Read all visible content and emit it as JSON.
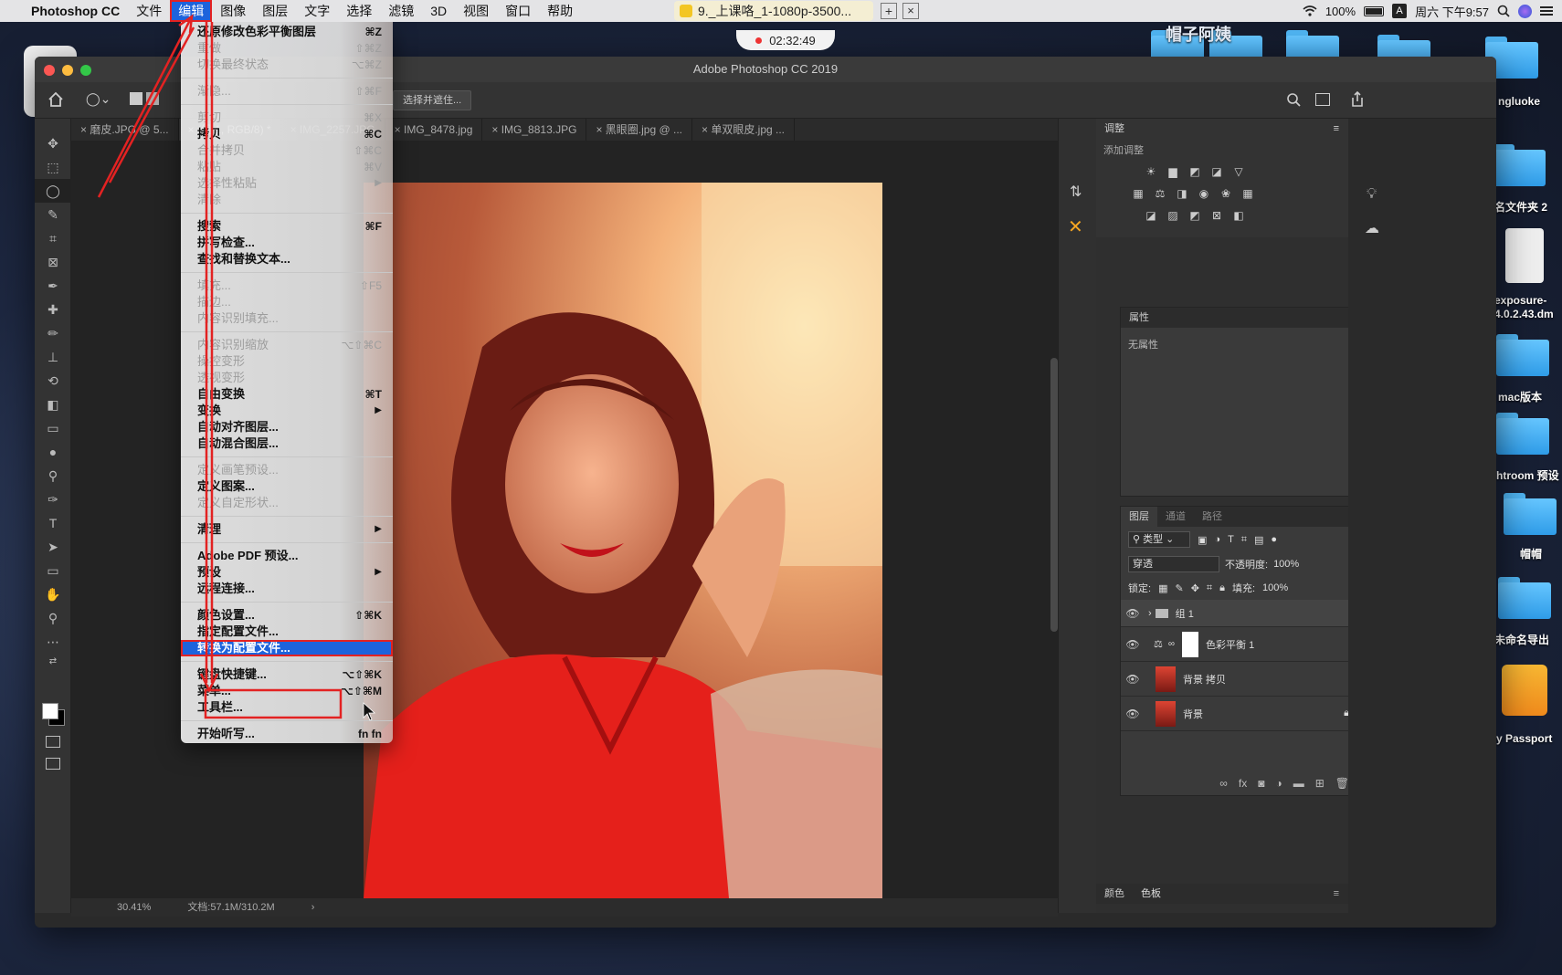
{
  "menubar": {
    "app": "Photoshop CC",
    "menus": [
      "文件",
      "编辑",
      "图像",
      "图层",
      "文字",
      "选择",
      "滤镜",
      "3D",
      "视图",
      "窗口",
      "帮助"
    ],
    "active_menu": "编辑",
    "video_title": "9._上课咯_1-1080p-3500...",
    "battery": "100%",
    "clock": "周六 下午9:57"
  },
  "recording": {
    "time": "02:32:49"
  },
  "desktop": {
    "labels": [
      "帽子阿姨",
      "ngluoke",
      "名文件夹 2",
      "exposure-4.0.2.43.dm",
      "mac版本",
      "htroom 预设",
      "帽帽",
      "未命名导出",
      "y Passport"
    ]
  },
  "ps": {
    "window_title": "Adobe Photoshop CC 2019",
    "options_button": "选择并遮住...",
    "tabs": [
      "磨皮.JPG @ 5...",
      "(组 1, RGB/8) *",
      "IMG_2257.JPG",
      "IMG_8478.jpg",
      "IMG_8813.JPG",
      "黑眼圈.jpg @ ...",
      "单双眼皮.jpg ..."
    ],
    "status_zoom": "30.41%",
    "status_doc": "文档:57.1M/310.2M"
  },
  "panels": {
    "adjust_tab": "调整",
    "adjust_add": "添加调整",
    "props_tab": "属性",
    "props_empty": "无属性",
    "layers_tabs": [
      "图层",
      "通道",
      "路径"
    ],
    "filter_kind": "类型",
    "blend_mode": "穿透",
    "opacity_label": "不透明度:",
    "opacity_value": "100%",
    "lock_label": "锁定:",
    "fill_label": "填充:",
    "fill_value": "100%",
    "layers": [
      {
        "name": "组 1",
        "type": "group"
      },
      {
        "name": "色彩平衡 1",
        "type": "adjustment"
      },
      {
        "name": "背景 拷贝",
        "type": "image"
      },
      {
        "name": "背景",
        "type": "image-locked"
      }
    ],
    "bottom_tabs": [
      "颜色",
      "色板"
    ]
  },
  "edit_menu": {
    "items": [
      {
        "label": "还原修改色彩平衡图层",
        "shortcut": "⌘Z",
        "enabled": true
      },
      {
        "label": "重做",
        "shortcut": "⇧⌘Z",
        "enabled": false
      },
      {
        "label": "切换最终状态",
        "shortcut": "⌥⌘Z",
        "enabled": false
      },
      {
        "sep": true
      },
      {
        "label": "渐隐...",
        "shortcut": "⇧⌘F",
        "enabled": false
      },
      {
        "sep": true
      },
      {
        "label": "剪切",
        "shortcut": "⌘X",
        "enabled": false
      },
      {
        "label": "拷贝",
        "shortcut": "⌘C",
        "enabled": true
      },
      {
        "label": "合并拷贝",
        "shortcut": "⇧⌘C",
        "enabled": false
      },
      {
        "label": "粘贴",
        "shortcut": "⌘V",
        "enabled": false
      },
      {
        "label": "选择性粘贴",
        "shortcut": "",
        "submenu": true,
        "enabled": false
      },
      {
        "label": "清除",
        "shortcut": "",
        "enabled": false
      },
      {
        "sep": true
      },
      {
        "label": "搜索",
        "shortcut": "⌘F",
        "enabled": true
      },
      {
        "label": "拼写检查...",
        "shortcut": "",
        "enabled": true
      },
      {
        "label": "查找和替换文本...",
        "shortcut": "",
        "enabled": true
      },
      {
        "sep": true
      },
      {
        "label": "填充...",
        "shortcut": "⇧F5",
        "enabled": false
      },
      {
        "label": "描边...",
        "shortcut": "",
        "enabled": false
      },
      {
        "label": "内容识别填充...",
        "shortcut": "",
        "enabled": false
      },
      {
        "sep": true
      },
      {
        "label": "内容识别缩放",
        "shortcut": "⌥⇧⌘C",
        "enabled": false
      },
      {
        "label": "操控变形",
        "shortcut": "",
        "enabled": false
      },
      {
        "label": "透视变形",
        "shortcut": "",
        "enabled": false
      },
      {
        "label": "自由变换",
        "shortcut": "⌘T",
        "enabled": true
      },
      {
        "label": "变换",
        "shortcut": "",
        "submenu": true,
        "enabled": true
      },
      {
        "label": "自动对齐图层...",
        "shortcut": "",
        "enabled": true
      },
      {
        "label": "自动混合图层...",
        "shortcut": "",
        "enabled": true
      },
      {
        "sep": true
      },
      {
        "label": "定义画笔预设...",
        "shortcut": "",
        "enabled": false
      },
      {
        "label": "定义图案...",
        "shortcut": "",
        "enabled": true
      },
      {
        "label": "定义自定形状...",
        "shortcut": "",
        "enabled": false
      },
      {
        "sep": true
      },
      {
        "label": "清理",
        "shortcut": "",
        "submenu": true,
        "enabled": true
      },
      {
        "sep": true
      },
      {
        "label": "Adobe PDF 预设...",
        "shortcut": "",
        "enabled": true
      },
      {
        "label": "预设",
        "shortcut": "",
        "submenu": true,
        "enabled": true
      },
      {
        "label": "远程连接...",
        "shortcut": "",
        "enabled": true
      },
      {
        "sep": true
      },
      {
        "label": "颜色设置...",
        "shortcut": "⇧⌘K",
        "enabled": true
      },
      {
        "label": "指定配置文件...",
        "shortcut": "",
        "enabled": true
      },
      {
        "label": "转换为配置文件...",
        "shortcut": "",
        "enabled": true,
        "highlighted": true
      },
      {
        "sep": true
      },
      {
        "label": "键盘快捷键...",
        "shortcut": "⌥⇧⌘K",
        "enabled": true
      },
      {
        "label": "菜单...",
        "shortcut": "⌥⇧⌘M",
        "enabled": true
      },
      {
        "label": "工具栏...",
        "shortcut": "",
        "enabled": true
      },
      {
        "sep": true
      },
      {
        "label": "开始听写...",
        "shortcut": "fn fn",
        "enabled": true
      }
    ]
  },
  "colors": {
    "highlight": "#1d63dc",
    "annotation": "#e32222"
  }
}
